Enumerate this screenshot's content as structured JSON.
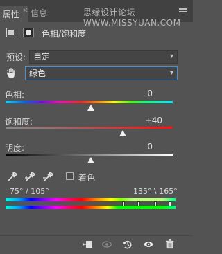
{
  "tabs": [
    {
      "label": "属性"
    },
    {
      "label": "信息"
    }
  ],
  "tab_close": "×",
  "watermark": "思缘设计论坛 WWW.MISSYUAN.COM",
  "header": {
    "title": "色相/饱和度"
  },
  "preset": {
    "label": "预设:",
    "value": "自定"
  },
  "channel": {
    "value": "绿色"
  },
  "hue": {
    "label": "色相:",
    "value": "0",
    "level_percent": 51
  },
  "saturation": {
    "label": "饱和度:",
    "value": "+40",
    "level_percent": 70
  },
  "lightness": {
    "label": "明度:",
    "value": "0",
    "level_percent": 51
  },
  "colorize": {
    "label": "着色",
    "checked": false
  },
  "range": {
    "left": "75° / 105°",
    "right": "135° \\ 165°"
  },
  "icons": {
    "caret": "▾"
  },
  "colors": {
    "panel_bg": "#535353",
    "tab_bar": "#414141",
    "focus_border": "#4a90d8"
  }
}
